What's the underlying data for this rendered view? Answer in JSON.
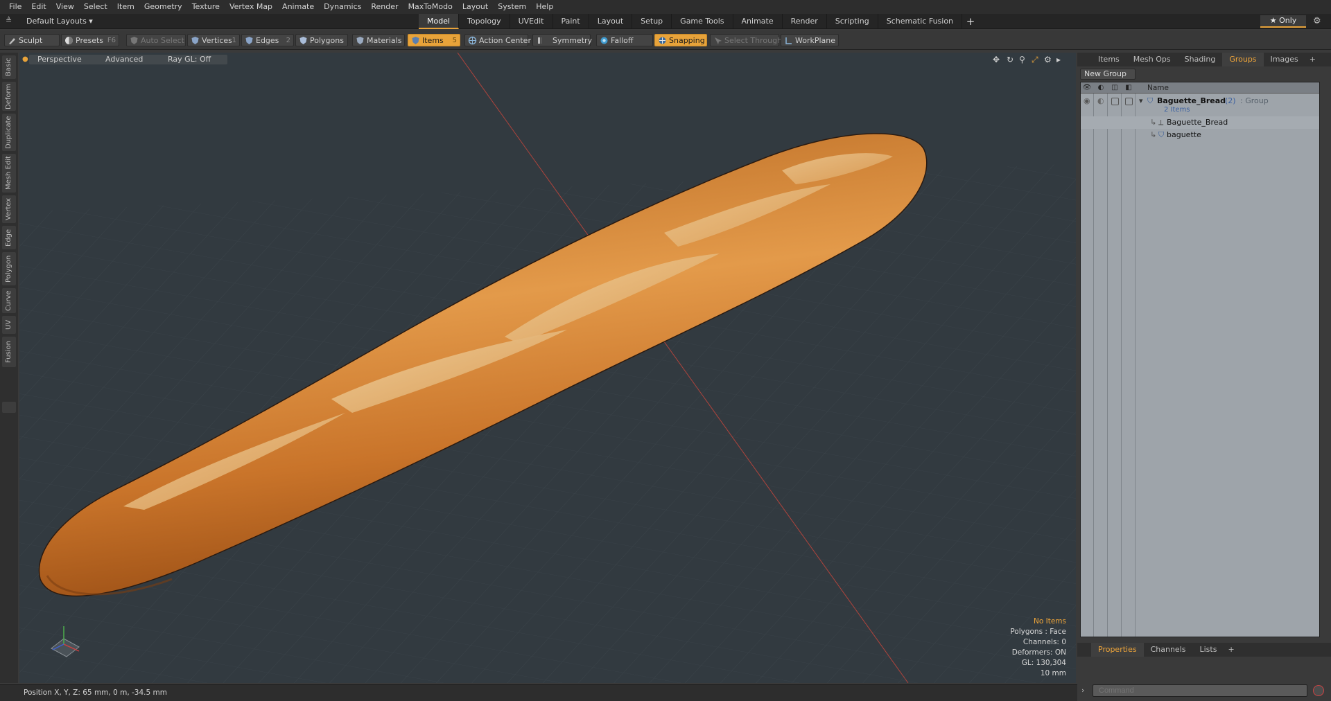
{
  "menu": [
    "File",
    "Edit",
    "View",
    "Select",
    "Item",
    "Geometry",
    "Texture",
    "Vertex Map",
    "Animate",
    "Dynamics",
    "Render",
    "MaxToModo",
    "Layout",
    "System",
    "Help"
  ],
  "layout_selector": "Default Layouts ▾",
  "layout_tabs": [
    {
      "label": "Model",
      "active": true
    },
    {
      "label": "Topology",
      "active": false
    },
    {
      "label": "UVEdit",
      "active": false
    },
    {
      "label": "Paint",
      "active": false
    },
    {
      "label": "Layout",
      "active": false
    },
    {
      "label": "Setup",
      "active": false
    },
    {
      "label": "Game Tools",
      "active": false
    },
    {
      "label": "Animate",
      "active": false
    },
    {
      "label": "Render",
      "active": false
    },
    {
      "label": "Scripting",
      "active": false
    },
    {
      "label": "Schematic Fusion",
      "active": false
    }
  ],
  "add_tab_symbol": "+",
  "only_label": "★  Only",
  "toolbar": {
    "sculpt": "Sculpt",
    "presets": "Presets",
    "presets_key": "F6",
    "auto_select": "Auto Select",
    "vertices": "Vertices",
    "vertices_key": "1",
    "edges": "Edges",
    "edges_key": "2",
    "polygons": "Polygons",
    "materials": "Materials",
    "items": "Items",
    "items_key": "5",
    "action_center": "Action Center",
    "symmetry": "Symmetry",
    "falloff": "Falloff",
    "snapping": "Snapping",
    "select_through": "Select Through",
    "workplane": "WorkPlane"
  },
  "left_tabs": [
    "Basic",
    "Deform",
    "Duplicate",
    "Mesh Edit",
    "Vertex",
    "Edge",
    "Polygon",
    "Curve",
    "UV",
    "Fusion"
  ],
  "viewport": {
    "perspective": "Perspective",
    "advanced": "Advanced",
    "raygl": "Ray GL: Off",
    "hud": {
      "no_items": "No Items",
      "polygons": "Polygons : Face",
      "channels": "Channels: 0",
      "deformers": "Deformers: ON",
      "gl": "GL: 130,304",
      "scale": "10 mm"
    }
  },
  "status": "Position X, Y, Z:  65 mm, 0 m, -34.5 mm",
  "right_panel": {
    "tabs": [
      {
        "label": "Items",
        "active": false
      },
      {
        "label": "Mesh Ops",
        "active": false
      },
      {
        "label": "Shading",
        "active": false
      },
      {
        "label": "Groups",
        "active": true
      },
      {
        "label": "Images",
        "active": false
      }
    ],
    "new_group": "New Group",
    "name_header": "Name",
    "group_name": "Baguette_Bread",
    "group_count": "(2)",
    "group_type": ": Group",
    "group_sub": "2 Items",
    "child1": "Baguette_Bread",
    "child2": "baguette",
    "bottom_tabs": [
      {
        "label": "Properties",
        "active": true
      },
      {
        "label": "Channels",
        "active": false
      },
      {
        "label": "Lists",
        "active": false
      }
    ],
    "command_placeholder": "Command"
  },
  "colors": {
    "accent": "#e8a33a",
    "viewport_bg": "#323a40",
    "bread_dark": "#a8581a",
    "bread_light": "#e9c486"
  }
}
